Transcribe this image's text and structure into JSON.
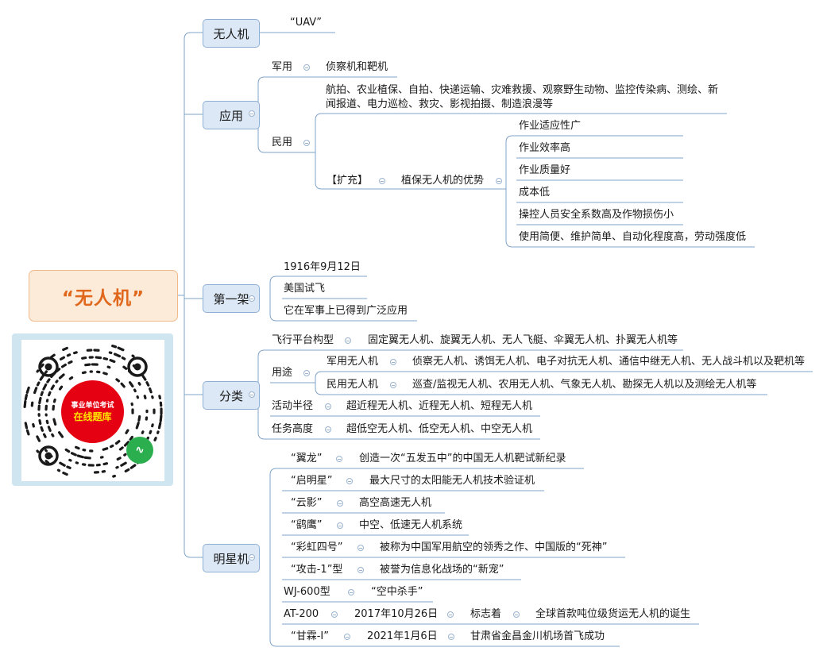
{
  "root": "“无人机”",
  "branches": {
    "uav": "无人机",
    "app": "应用",
    "first": "第一架",
    "cls": "分类",
    "star": "明星机"
  },
  "uav": {
    "name": "“UAV”"
  },
  "app": {
    "military": "军用",
    "military_desc": "侦察机和靶机",
    "civil": "民用",
    "civil_desc": "航拍、农业植保、自拍、快递运输、灾难救援、观察野生动物、监控传染病、测绘、新闻报道、电力巡检、救灾、影视拍摄、制造浪漫等",
    "expand": "【扩充】",
    "advantage_title": "植保无人机的优势",
    "advantages": [
      "作业适应性广",
      "作业效率高",
      "作业质量好",
      "成本低",
      "操控人员安全系数高及作物损伤小",
      "使用简便、维护简单、自动化程度高，劳动强度低"
    ]
  },
  "first": [
    "1916年9月12日",
    "美国试飞",
    "它在军事上已得到广泛应用"
  ],
  "cls": {
    "platform": "飞行平台构型",
    "platform_desc": "固定翼无人机、旋翼无人机、无人飞艇、伞翼无人机、扑翼无人机等",
    "use": "用途",
    "mil": "军用无人机",
    "mil_desc": "侦察无人机、诱饵无人机、电子对抗无人机、通信中继无人机、无人战斗机以及靶机等",
    "civ": "民用无人机",
    "civ_desc": "巡查/监视无人机、农用无人机、气象无人机、勘探无人机以及测绘无人机等",
    "radius": "活动半径",
    "radius_desc": "超近程无人机、近程无人机、短程无人机",
    "alt": "任务高度",
    "alt_desc": "超低空无人机、低空无人机、中空无人机"
  },
  "star": {
    "items": [
      {
        "name": "“翼龙”",
        "desc": "创造一次“五发五中”的中国无人机靶试新纪录"
      },
      {
        "name": "“启明星”",
        "desc": "最大尺寸的太阳能无人机技术验证机"
      },
      {
        "name": "“云影”",
        "desc": "高空高速无人机"
      },
      {
        "name": "“鹞鹰”",
        "desc": "中空、低速无人机系统"
      },
      {
        "name": "“彩虹四号”",
        "desc": "被称为中国军用航空的领秀之作、中国版的“死神”"
      },
      {
        "name": "“攻击-1”型",
        "desc": "被誉为信息化战场的“新宠”"
      },
      {
        "name": "WJ-600型",
        "desc": "“空中杀手”"
      }
    ],
    "at200": {
      "name": "AT-200",
      "date": "2017年10月26日",
      "mark": "标志着",
      "desc": "全球首款吨位级货运无人机的诞生"
    },
    "ganlin": {
      "name": "“甘霖-I”",
      "date": "2021年1月6日",
      "desc": "甘肃省金昌金川机场首飞成功"
    }
  },
  "qr": {
    "line1": "事业单位考试",
    "line2": "在线题库"
  },
  "colors": {
    "line": "#7fa3c8",
    "root_text": "#e0681c",
    "root_fill": "#fdebd9",
    "branch_fill": "#dce8f5",
    "qr_red": "#e50012"
  }
}
